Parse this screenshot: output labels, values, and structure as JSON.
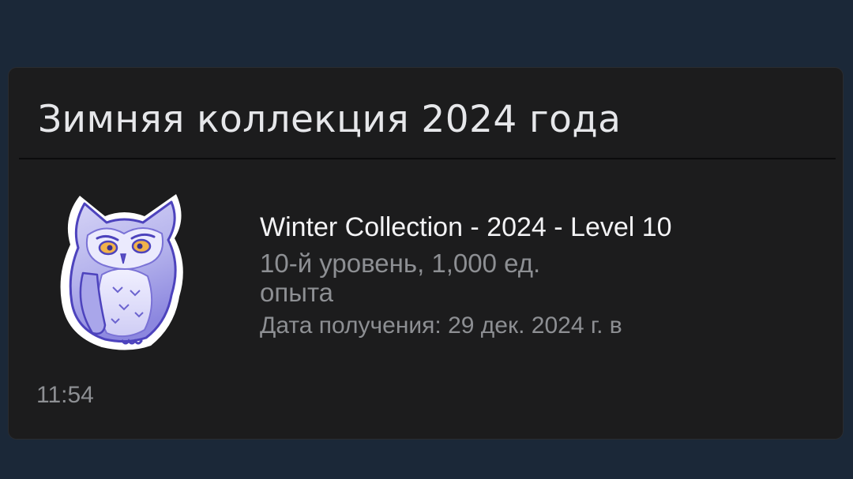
{
  "card": {
    "title": "Зимняя коллекция 2024 года"
  },
  "badge": {
    "icon": "owl-badge-icon",
    "name": "Winter Collection - 2024 - Level 10",
    "xp": "10-й уровень, 1,000 ед. опыта",
    "unlocked_label": "Дата получения: 29 дек. 2024 г. в",
    "unlocked_time": "11:54"
  },
  "colors": {
    "background": "#1b2838",
    "card": "#1c1c1d",
    "title_text": "#e6e7ea",
    "secondary_text": "#8d8f93",
    "owl_body": "#b9b8ec",
    "owl_outline": "#5a4ec4",
    "owl_eyes": "#e0a03a"
  }
}
